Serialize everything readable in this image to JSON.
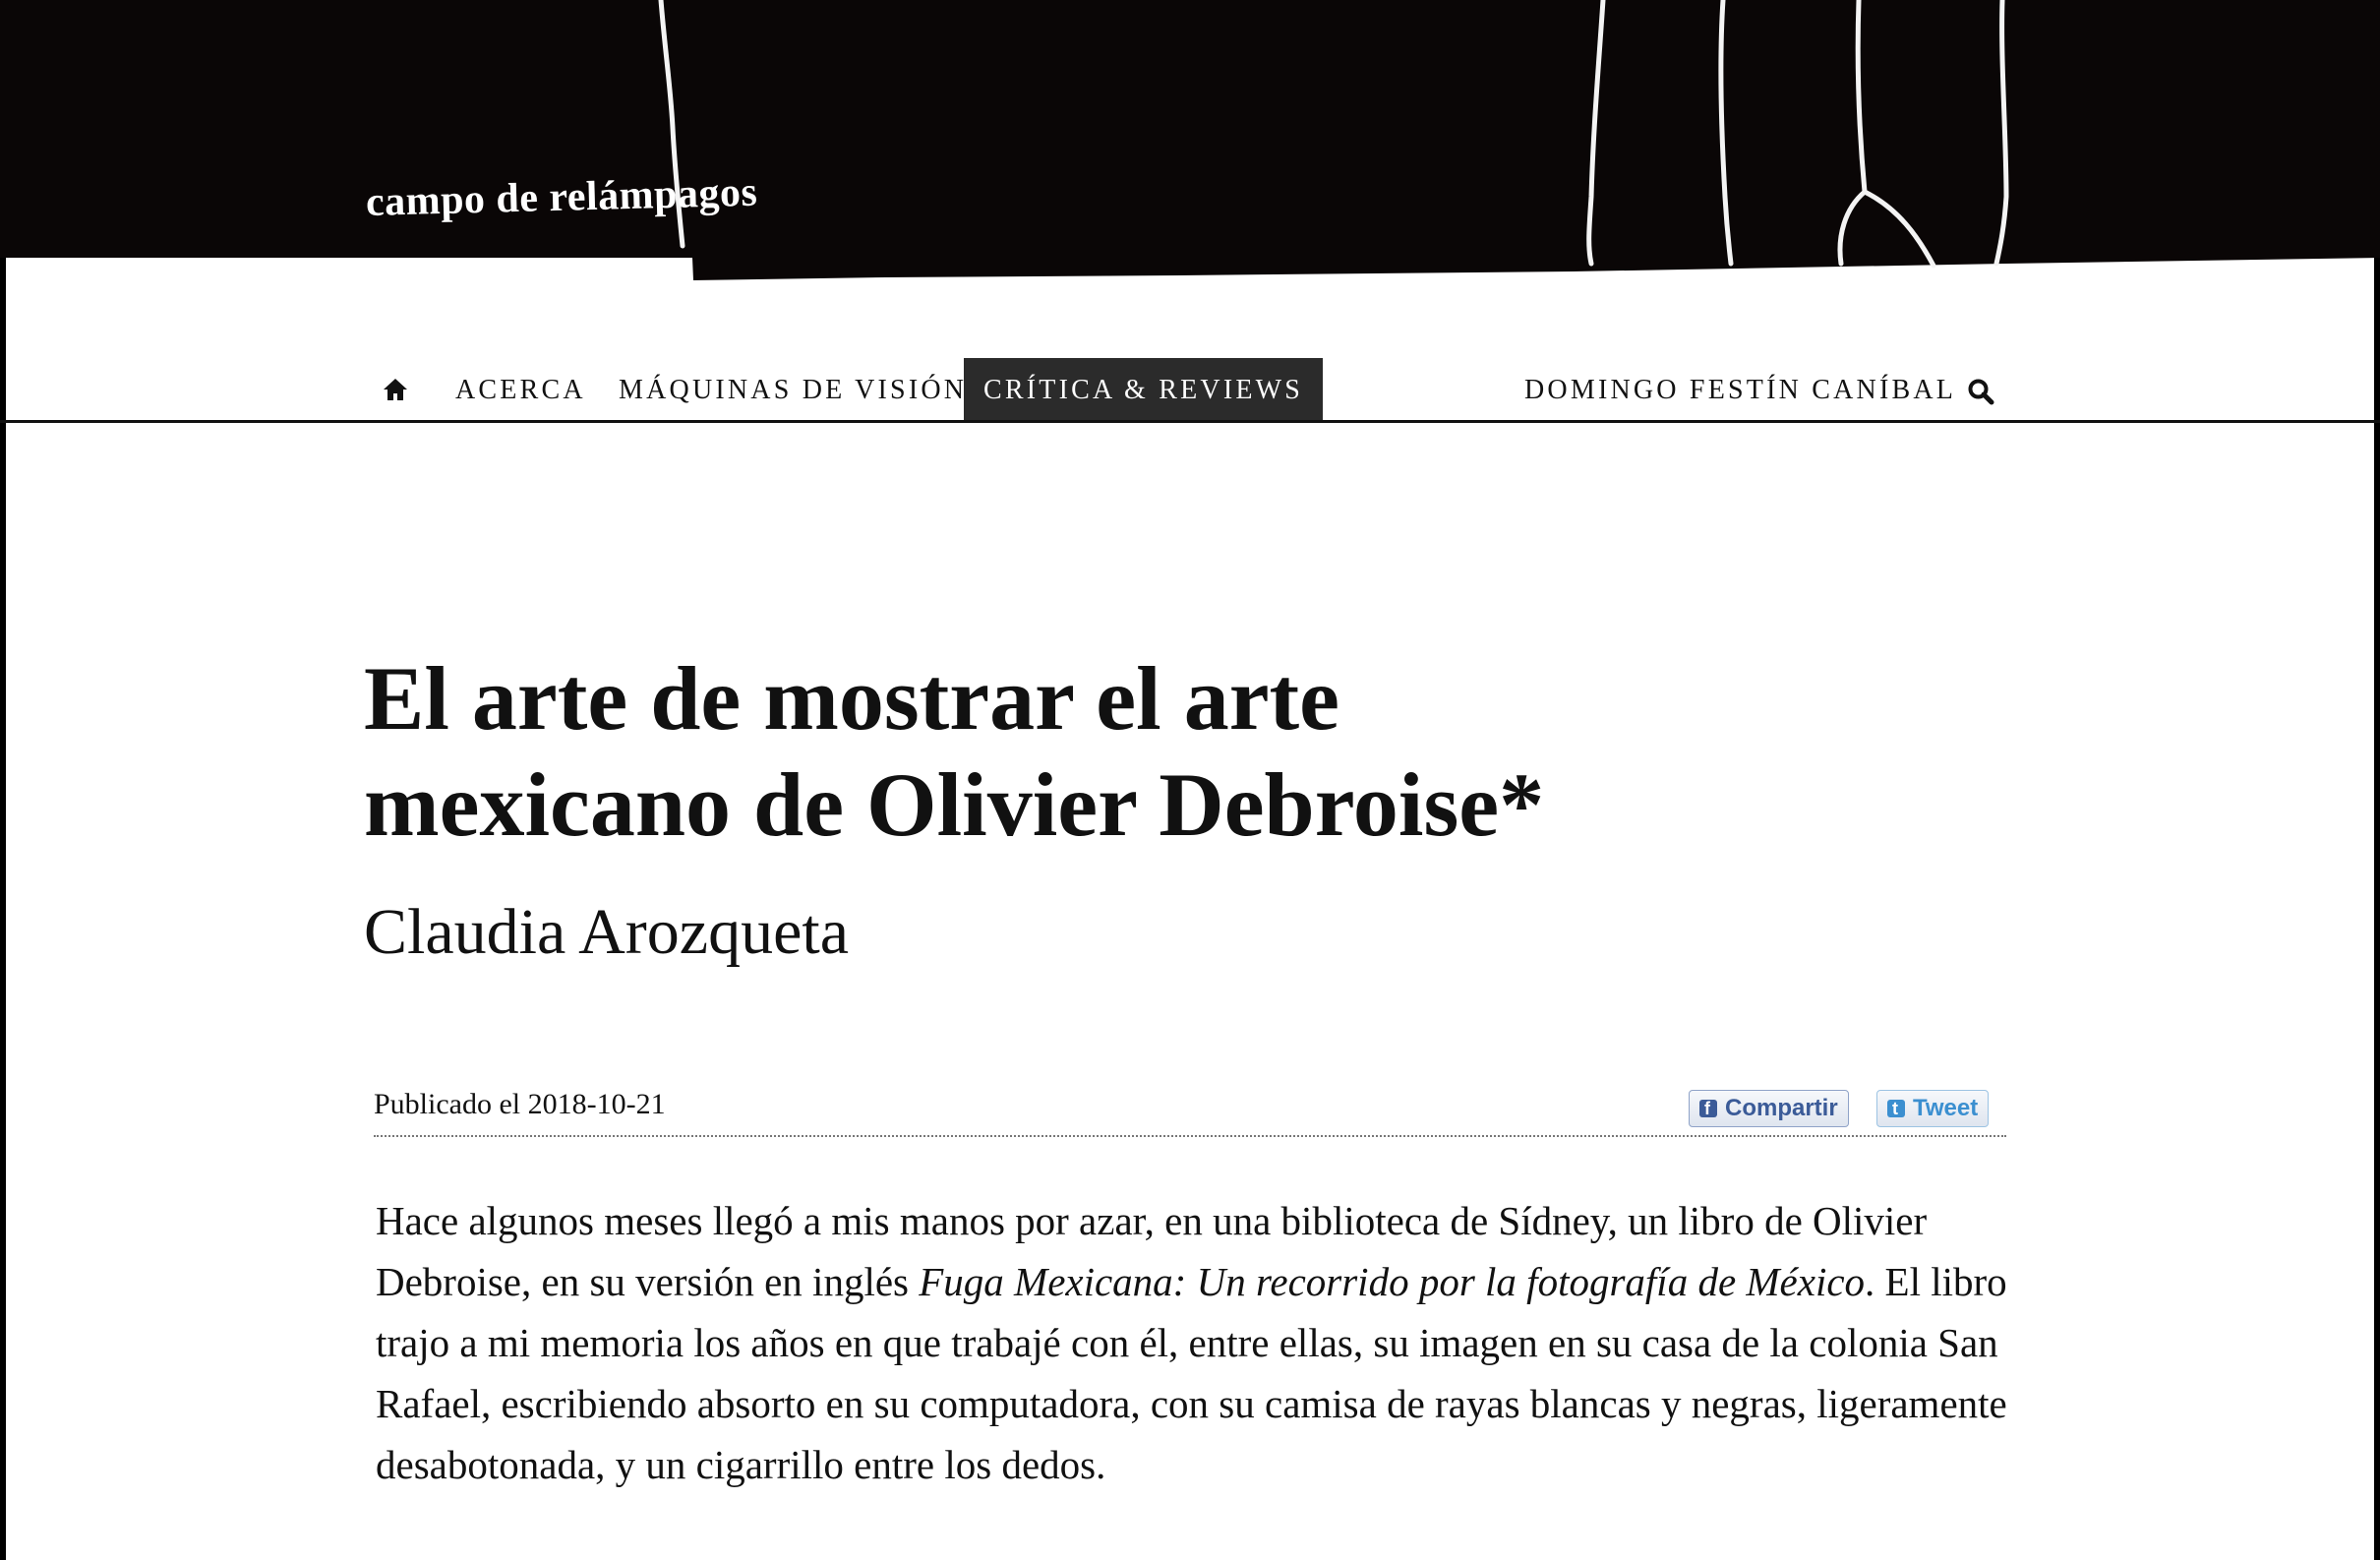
{
  "header": {
    "site_title": "campo de relámpagos"
  },
  "nav": {
    "home_icon": "home-icon",
    "items": [
      {
        "label": "ACERCA",
        "active": false
      },
      {
        "label": "MÁQUINAS DE VISIÓN",
        "active": false
      },
      {
        "label": "CRÍTICA & REVIEWS",
        "active": true
      }
    ],
    "right_item": "DOMINGO FESTÍN CANÍBAL",
    "search_icon": "search-icon",
    "active_bg": "#2b2b2b"
  },
  "article": {
    "title": "El arte de mostrar el arte mexicano de Olivier Debroise*",
    "author": "Claudia Arozqueta",
    "published": "Publicado el 2018-10-21",
    "share": {
      "facebook": "Compartir",
      "twitter": "Tweet"
    },
    "paragraph": {
      "before": "Hace algunos meses llegó a mis manos por azar, en una biblioteca de Sídney, un libro de Olivier Debroise, en su versión en inglés ",
      "italic": "Fuga Mexicana: Un recorrido por la fotografía de México",
      "after": ". El libro trajo a mi memoria los años en que trabajé con él, entre ellas, su imagen en su casa de la colonia San Rafael, escribiendo absorto en su computadora, con su camisa de rayas blancas y negras, ligeramente desabotonada, y un cigarrillo entre los dedos."
    }
  }
}
